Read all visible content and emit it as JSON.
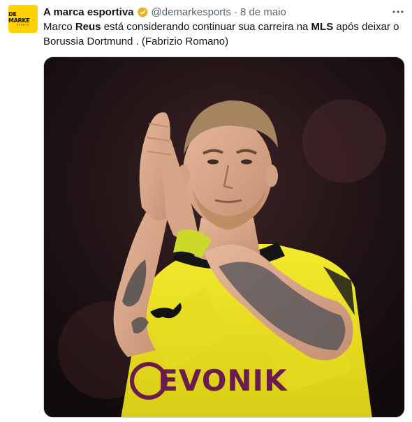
{
  "tweet": {
    "author_name": "A marca esportiva",
    "handle": "@demarkesports",
    "separator": "·",
    "date": "8 de maio",
    "text_parts": {
      "p1": "Marco ",
      "p2": "Reus",
      "p3": " está considerando continuar sua carreira na ",
      "p4": "MLS",
      "p5": " após deixar o Borussia Dortmund . (Fabrizio Romano)"
    },
    "avatar": {
      "logo_main": "DE MARKE",
      "logo_sub": "SPORTS"
    },
    "media": {
      "jersey_sponsor": "evonik",
      "jersey_brand_icon": "puma-logo",
      "accent_yellow": "#f2e92a",
      "background_dark": "#1c1114"
    },
    "icons": {
      "verified": "verified-badge-icon",
      "more": "more-options-icon"
    },
    "colors": {
      "verified_gold": "#e8b21e",
      "secondary_text": "#536471"
    }
  }
}
